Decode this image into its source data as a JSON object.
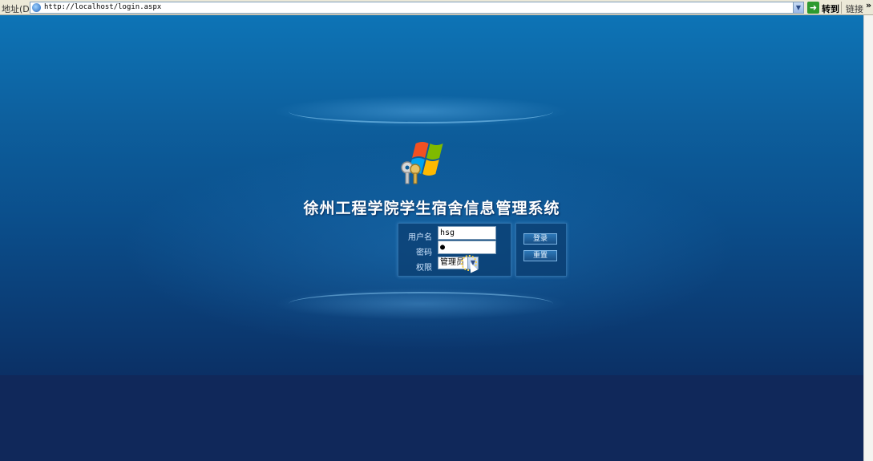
{
  "browser": {
    "address_label": "地址(D)",
    "url": "http://localhost/login.aspx",
    "go_label": "转到",
    "links_label": "链接",
    "more": "»"
  },
  "app": {
    "title": "徐州工程学院学生宿舍信息管理系统"
  },
  "login": {
    "username_label": "用户名",
    "username_value": "hsg",
    "password_label": "密码",
    "password_value": "●",
    "role_label": "权限",
    "role_selected": "管理员",
    "login_button": "登录",
    "reset_button": "重置"
  },
  "icons": {
    "page": "ie-page-icon",
    "go": "go-arrow-icon",
    "logo": "windows-keys-logo-icon",
    "dropdown": "chevron-down-icon"
  }
}
